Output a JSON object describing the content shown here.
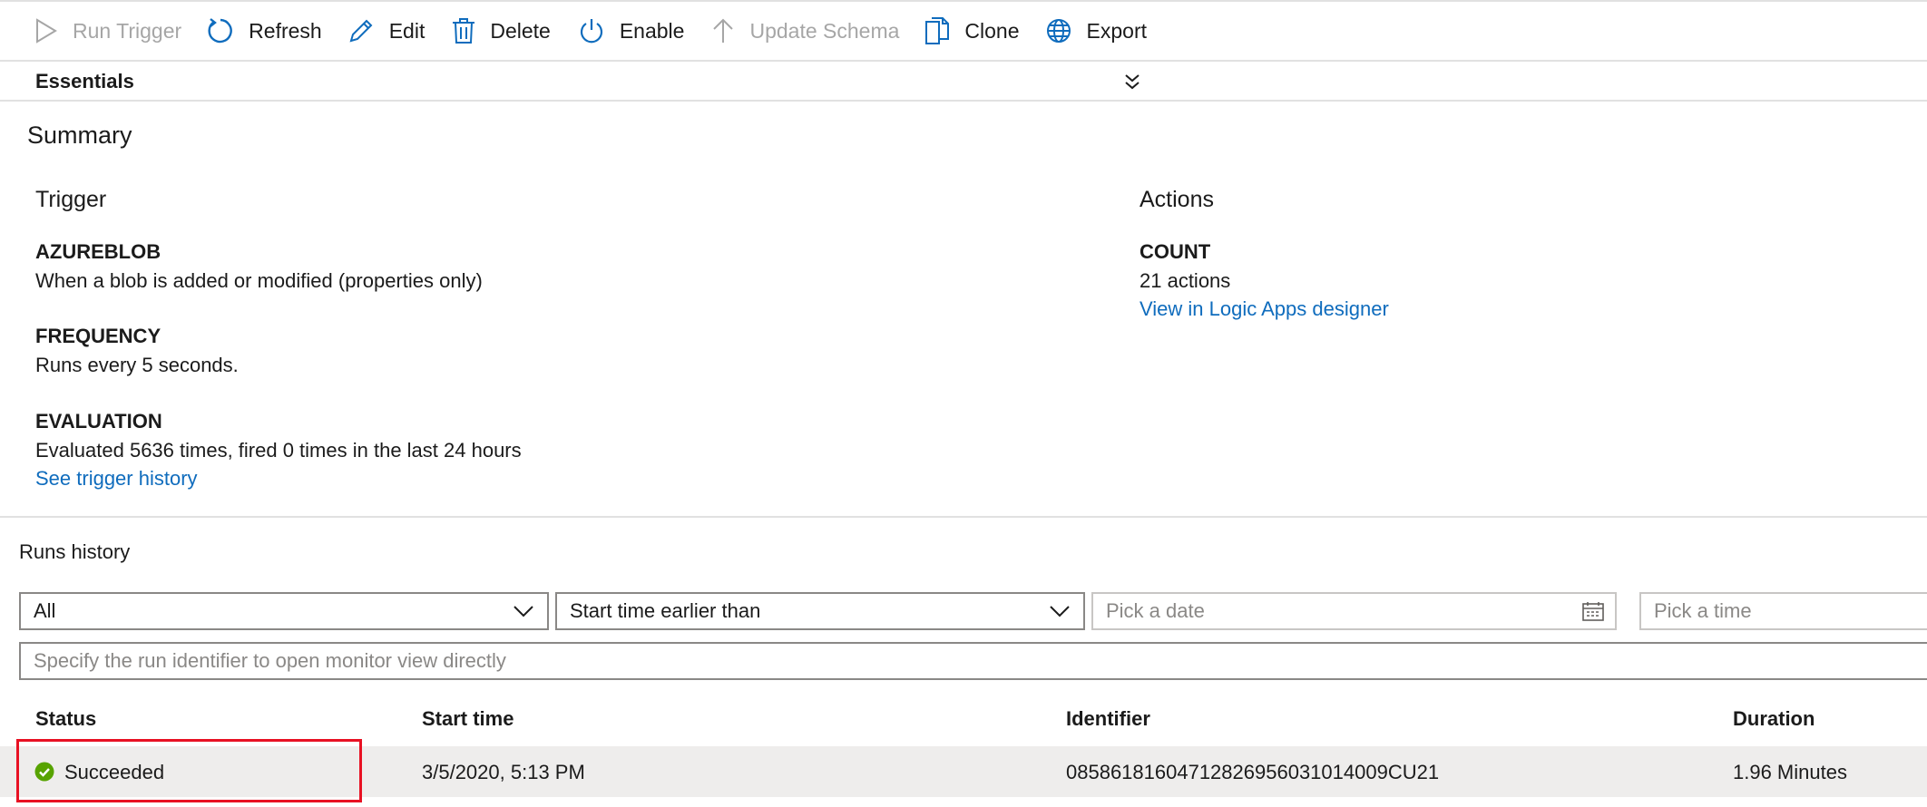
{
  "toolbar": {
    "run_trigger": "Run Trigger",
    "refresh": "Refresh",
    "edit": "Edit",
    "delete": "Delete",
    "enable": "Enable",
    "update_schema": "Update Schema",
    "clone": "Clone",
    "export": "Export"
  },
  "essentials": {
    "title": "Essentials"
  },
  "summary": {
    "title": "Summary",
    "trigger": {
      "heading": "Trigger",
      "type_label": "AZUREBLOB",
      "type_value": "When a blob is added or modified (properties only)",
      "frequency_label": "FREQUENCY",
      "frequency_value": "Runs every 5 seconds.",
      "evaluation_label": "EVALUATION",
      "evaluation_value": "Evaluated 5636 times, fired 0 times in the last 24 hours",
      "history_link": "See trigger history"
    },
    "actions": {
      "heading": "Actions",
      "count_label": "COUNT",
      "count_value": "21 actions",
      "designer_link": "View in Logic Apps designer"
    }
  },
  "runs_history": {
    "title": "Runs history",
    "filters": {
      "status_value": "All",
      "time_filter_value": "Start time earlier than",
      "date_placeholder": "Pick a date",
      "time_placeholder": "Pick a time",
      "identifier_placeholder": "Specify the run identifier to open monitor view directly"
    },
    "columns": [
      "Status",
      "Start time",
      "Identifier",
      "Duration"
    ],
    "rows": [
      {
        "status": "Succeeded",
        "start_time": "3/5/2020, 5:13 PM",
        "identifier": "08586181604712826956031014009CU21",
        "duration": "1.96 Minutes"
      }
    ]
  },
  "colors": {
    "accent": "#0f6cbd",
    "success": "#57a300",
    "highlight": "#e81123",
    "row_background": "#eeedec"
  }
}
